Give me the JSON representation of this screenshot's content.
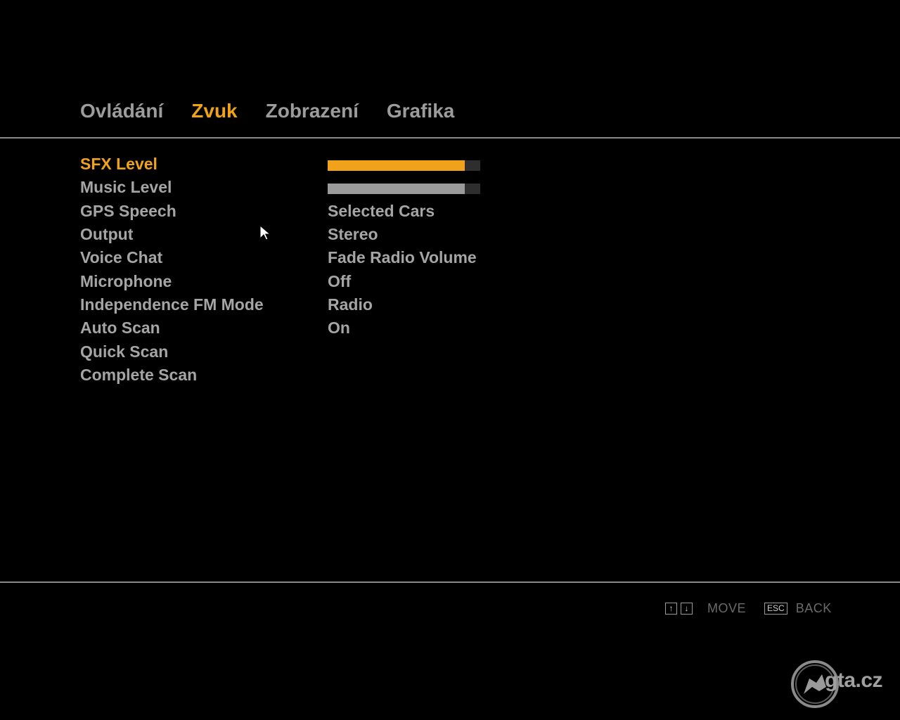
{
  "tabs": [
    {
      "label": "Ovládání",
      "active": false
    },
    {
      "label": "Zvuk",
      "active": true
    },
    {
      "label": "Zobrazení",
      "active": false
    },
    {
      "label": "Grafika",
      "active": false
    }
  ],
  "settings": [
    {
      "label": "SFX Level",
      "type": "slider",
      "level_percent": 90,
      "active": true
    },
    {
      "label": "Music Level",
      "type": "slider",
      "level_percent": 90,
      "active": false
    },
    {
      "label": "GPS Speech",
      "type": "value",
      "value": "Selected Cars"
    },
    {
      "label": "Output",
      "type": "value",
      "value": "Stereo"
    },
    {
      "label": "Voice Chat",
      "type": "value",
      "value": "Fade Radio Volume"
    },
    {
      "label": "Microphone",
      "type": "value",
      "value": "Off"
    },
    {
      "label": "Independence FM Mode",
      "type": "value",
      "value": "Radio"
    },
    {
      "label": "Auto Scan",
      "type": "value",
      "value": "On"
    },
    {
      "label": "Quick Scan",
      "type": "action",
      "value": ""
    },
    {
      "label": "Complete Scan",
      "type": "action",
      "value": ""
    }
  ],
  "hints": {
    "up_key": "↑",
    "down_key": "↓",
    "move_label": "MOVE",
    "esc_key": "ESC",
    "back_label": "BACK"
  },
  "watermark": {
    "text": "gta.cz",
    "icon": "rockstar-style-logo-icon"
  },
  "colors": {
    "accent": "#f0a21a",
    "text": "#a5a5a5",
    "background": "#000000"
  }
}
